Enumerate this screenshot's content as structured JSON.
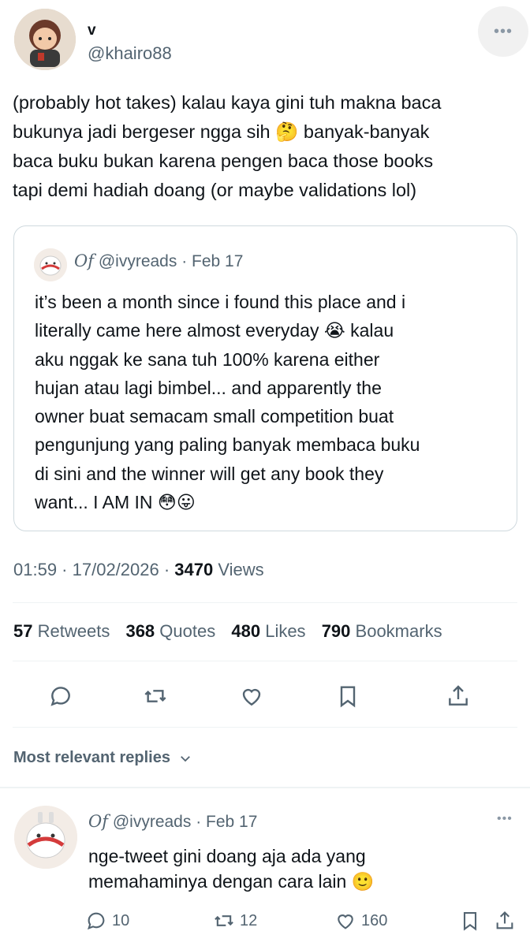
{
  "author": {
    "name": "v",
    "handle": "@khairo88"
  },
  "tweet": {
    "text": "(probably hot takes) kalau kaya gini tuh makna baca\nbukunya jadi bergeser ngga sih 🤔 banyak-banyak\nbaca buku bukan karena pengen baca those books\ntapi demi hadiah doang (or maybe validations lol)"
  },
  "quote": {
    "logo_glyph": "O𝑓",
    "handle": "@ivyreads",
    "date": "Feb 17",
    "text": "it’s been a month since i found this place and i\nliterally came here almost everyday 😭 kalau\naku nggak ke sana tuh 100% karena either\nhujan atau lagi bimbel... and apparently the\nowner buat semacam small competition buat\npengunjung yang paling banyak membaca buku\ndi sini and the winner will get any book they\nwant... I AM IN 😳😛"
  },
  "meta": {
    "time": "01:59",
    "date": "17/02/2026",
    "views": "3470",
    "views_label": "Views"
  },
  "stats": {
    "retweets": "57",
    "retweets_label": "Retweets",
    "quotes": "368",
    "quotes_label": "Quotes",
    "likes": "480",
    "likes_label": "Likes",
    "bookmarks": "790",
    "bookmarks_label": "Bookmarks"
  },
  "actions": {
    "icons": [
      "reply-icon",
      "retweet-icon",
      "like-icon",
      "bookmark-icon",
      "share-icon"
    ]
  },
  "replies_filter": {
    "label": "Most relevant replies"
  },
  "reply": {
    "logo_glyph": "O𝑓",
    "handle": "@ivyreads",
    "date": "Feb 17",
    "text": "nge-tweet gini doang aja ada yang\nmemahaminya dengan cara lain 🙂",
    "replies": "10",
    "retweets": "12",
    "likes": "160"
  },
  "colors": {
    "text": "#0f1419",
    "secondary": "#536471",
    "border": "#cfd9de",
    "divider": "#eff3f4"
  }
}
